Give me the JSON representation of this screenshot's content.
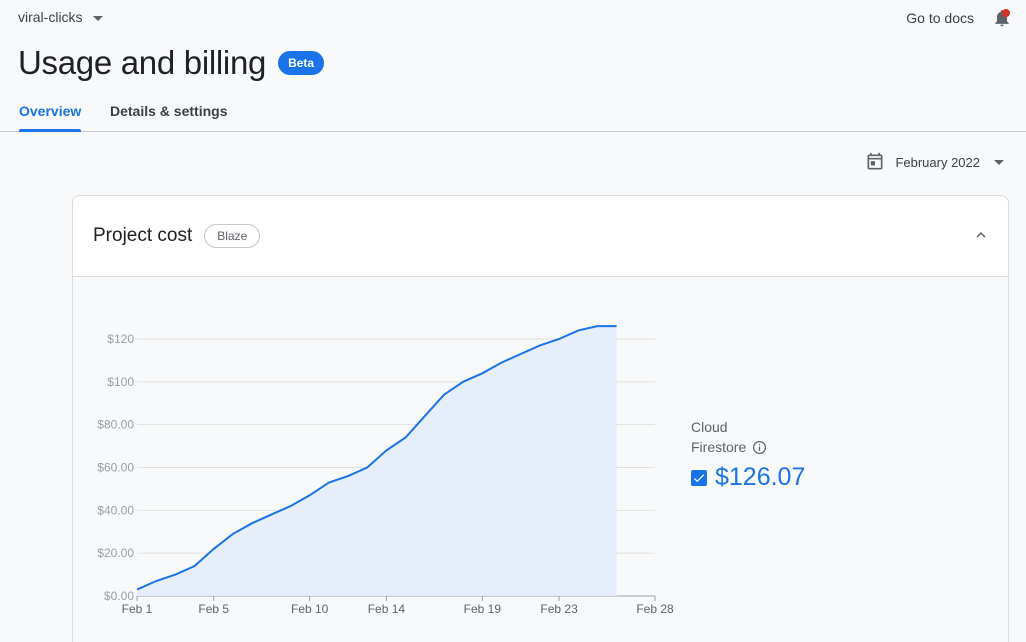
{
  "header": {
    "project_name": "viral-clicks",
    "docs_link": "Go to docs"
  },
  "page": {
    "title": "Usage and billing",
    "badge": "Beta"
  },
  "tabs": [
    {
      "label": "Overview",
      "active": true
    },
    {
      "label": "Details & settings",
      "active": false
    }
  ],
  "date_picker": {
    "selected": "February 2022"
  },
  "card": {
    "title": "Project cost",
    "plan": "Blaze"
  },
  "legend": {
    "items": [
      {
        "name_line1": "Cloud",
        "name_line2": "Firestore",
        "value": "$126.07",
        "checked": true
      }
    ]
  },
  "colors": {
    "accent": "#1a73e8",
    "line": "#1a73e8",
    "fill": "#e3ecfb"
  },
  "chart_data": {
    "type": "area",
    "xlabel": "",
    "ylabel": "",
    "x_domain": [
      "Feb 1",
      "Feb 28"
    ],
    "x_ticks": [
      "Feb 1",
      "Feb 5",
      "Feb 10",
      "Feb 14",
      "Feb 19",
      "Feb 23",
      "Feb 28"
    ],
    "y_ticks": [
      "$0.00",
      "$20.00",
      "$40.00",
      "$60.00",
      "$80.00",
      "$100",
      "$120"
    ],
    "ylim": [
      0,
      120
    ],
    "grid": true,
    "series": [
      {
        "name": "Cloud Firestore",
        "x": [
          "Feb 1",
          "Feb 2",
          "Feb 3",
          "Feb 4",
          "Feb 5",
          "Feb 6",
          "Feb 7",
          "Feb 8",
          "Feb 9",
          "Feb 10",
          "Feb 11",
          "Feb 12",
          "Feb 13",
          "Feb 14",
          "Feb 15",
          "Feb 16",
          "Feb 17",
          "Feb 18",
          "Feb 19",
          "Feb 20",
          "Feb 21",
          "Feb 22",
          "Feb 23",
          "Feb 24",
          "Feb 25",
          "Feb 26"
        ],
        "values": [
          3,
          7,
          10,
          14,
          22,
          29,
          34,
          38,
          42,
          47,
          53,
          56,
          60,
          68,
          74,
          84,
          94,
          100,
          104,
          109,
          113,
          117,
          120,
          124,
          126,
          126
        ]
      }
    ]
  }
}
